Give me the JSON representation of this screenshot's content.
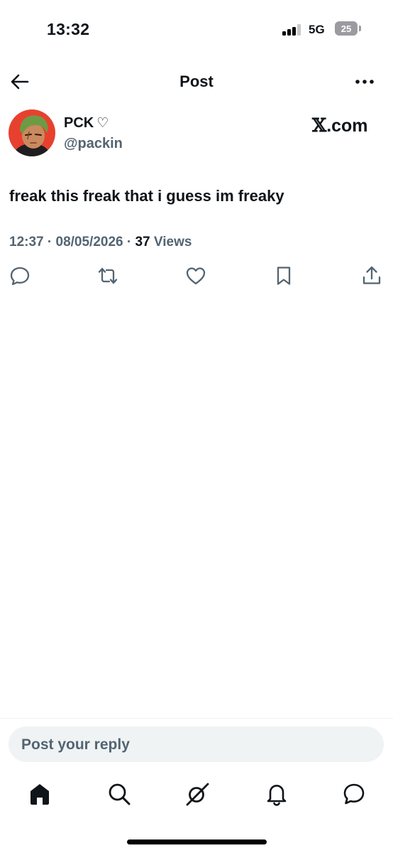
{
  "status_bar": {
    "time": "13:32",
    "network": "5G",
    "battery_level": "25"
  },
  "header": {
    "title": "Post",
    "back_icon": "arrow-left-icon",
    "more_icon": "more-horizontal-icon"
  },
  "post": {
    "author": {
      "display_name": "PCK",
      "name_glyph": "♡",
      "handle": "@packin",
      "avatar_icon": "avatar-illustration"
    },
    "source_badge": {
      "letter": "𝕏",
      "suffix": ".com"
    },
    "text": "freak this freak that i guess im freaky",
    "time": "12:37",
    "date": "08/05/2026",
    "separator": "·",
    "views_count": "37",
    "views_label": "Views",
    "actions": [
      {
        "name": "reply",
        "icon": "reply-icon"
      },
      {
        "name": "repost",
        "icon": "repost-icon"
      },
      {
        "name": "like",
        "icon": "heart-icon"
      },
      {
        "name": "bookmark",
        "icon": "bookmark-icon"
      },
      {
        "name": "share",
        "icon": "share-icon"
      }
    ]
  },
  "reply_bar": {
    "placeholder": "Post your reply"
  },
  "tab_bar": {
    "items": [
      {
        "name": "home",
        "icon": "home-icon",
        "active": true
      },
      {
        "name": "search",
        "icon": "search-icon",
        "active": false
      },
      {
        "name": "grok",
        "icon": "grok-icon",
        "active": false
      },
      {
        "name": "notifications",
        "icon": "bell-icon",
        "active": false
      },
      {
        "name": "messages",
        "icon": "message-icon",
        "active": false
      }
    ]
  },
  "colors": {
    "text_primary": "#0f1419",
    "text_secondary": "#536471",
    "reply_background": "#eff3f4",
    "avatar_background": "#e8402f"
  }
}
